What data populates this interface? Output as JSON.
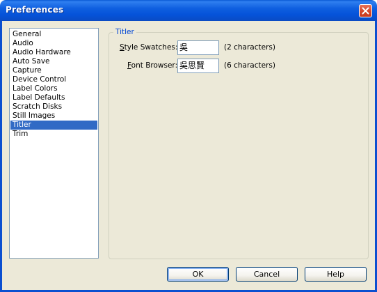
{
  "window": {
    "title": "Preferences"
  },
  "sidebar": {
    "items": [
      {
        "label": "General"
      },
      {
        "label": "Audio"
      },
      {
        "label": "Audio Hardware"
      },
      {
        "label": "Auto Save"
      },
      {
        "label": "Capture"
      },
      {
        "label": "Device Control"
      },
      {
        "label": "Label Colors"
      },
      {
        "label": "Label Defaults"
      },
      {
        "label": "Scratch Disks"
      },
      {
        "label": "Still Images"
      },
      {
        "label": "Titler"
      },
      {
        "label": "Trim"
      }
    ],
    "selected": "Titler"
  },
  "panel": {
    "legend": "Titler",
    "style_swatches": {
      "label_mnemonic": "S",
      "label_rest": "tyle Swatches:",
      "value": "吳",
      "note": "(2 characters)"
    },
    "font_browser": {
      "label_mnemonic": "F",
      "label_rest": "ont Browser:",
      "value": "吳思賢",
      "note": "(6 characters)"
    }
  },
  "buttons": {
    "ok": "OK",
    "cancel": "Cancel",
    "help": "Help"
  },
  "colors": {
    "titlebar": "#0553d9",
    "selection": "#316ac5",
    "legend_text": "#0046d5",
    "dialog_bg": "#ece9d8"
  }
}
